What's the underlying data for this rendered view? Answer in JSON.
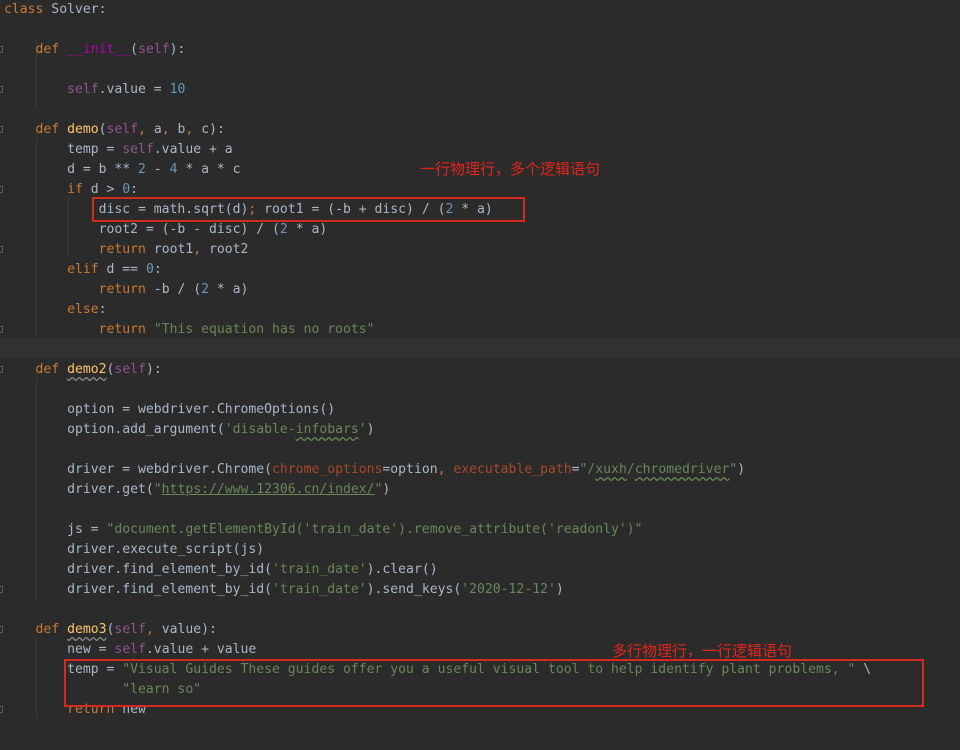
{
  "code_editor": {
    "language": "python",
    "lines": [
      "class Solver:",
      "",
      "    def __init__(self):",
      "",
      "        self.value = 10",
      "",
      "    def demo(self, a, b, c):",
      "        temp = self.value + a",
      "        d = b ** 2 - 4 * a * c",
      "        if d > 0:",
      "            disc = math.sqrt(d); root1 = (-b + disc) / (2 * a)",
      "            root2 = (-b - disc) / (2 * a)",
      "            return root1, root2",
      "        elif d == 0:",
      "            return -b / (2 * a)",
      "        else:",
      "            return \"This equation has no roots\"",
      "",
      "    def demo2(self):",
      "",
      "        option = webdriver.ChromeOptions()",
      "        option.add_argument('disable-infobars')",
      "",
      "        driver = webdriver.Chrome(chrome_options=option, executable_path=\"/xuxh/chromedriver\")",
      "        driver.get(\"https://www.12306.cn/index/\")",
      "",
      "        js = \"document.getElementById('train_date').remove_attribute('readonly')\"",
      "        driver.execute_script(js)",
      "        driver.find_element_by_id('train_date').clear()",
      "        driver.find_element_by_id('train_date').send_keys('2020-12-12')",
      "",
      "    def demo3(self, value):",
      "        new = self.value + value",
      "        temp = \"Visual Guides These guides offer you a useful visual tool to help identify plant problems, \" \\",
      "               \"learn so\"",
      "        return new"
    ]
  },
  "annotations": {
    "note_single_physical_line": "一行物理行，多个逻辑语句",
    "note_multi_physical_line": "多行物理行，一行逻辑语句"
  },
  "colors": {
    "background": "#2b2b2b",
    "keyword": "#cc7832",
    "self": "#94558d",
    "function": "#ffc66d",
    "number": "#6897bb",
    "string": "#6a8759",
    "param": "#aa4926",
    "annotation_red": "#d42a20"
  }
}
